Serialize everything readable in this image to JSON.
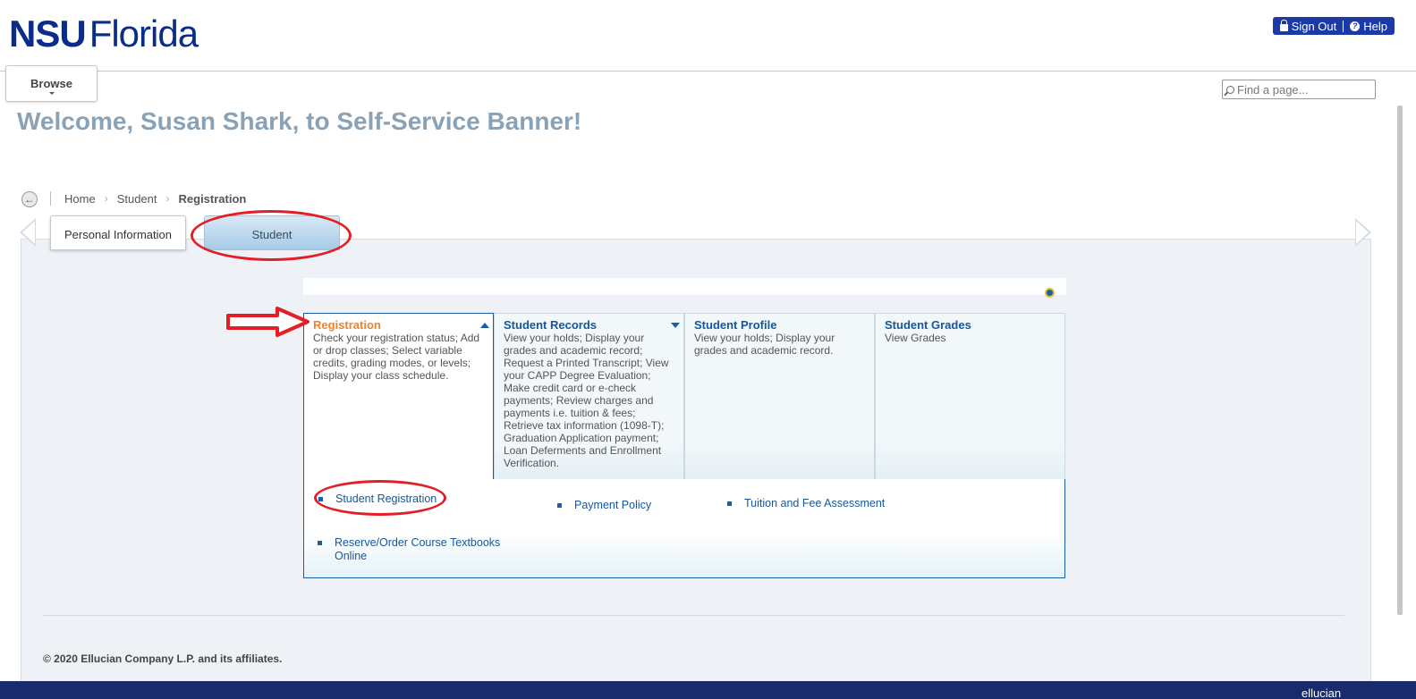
{
  "header": {
    "logo_bold": "NSU",
    "logo_light": "Florida",
    "sign_out": "Sign Out",
    "help": "Help"
  },
  "browse_label": "Browse",
  "search": {
    "placeholder": "Find a page..."
  },
  "welcome": "Welcome, Susan Shark, to Self-Service Banner!",
  "breadcrumb": {
    "items": [
      "Home",
      "Student",
      "Registration"
    ]
  },
  "tabs": [
    {
      "label": "Personal Information",
      "active": false
    },
    {
      "label": "Student",
      "active": true
    }
  ],
  "cards": [
    {
      "title": "Registration",
      "desc": "Check your registration status; Add or drop classes; Select variable credits, grading modes, or levels; Display your class schedule.",
      "active": true
    },
    {
      "title": "Student Records",
      "desc": "View your holds; Display your grades and academic record; Request a Printed Transcript; View your CAPP Degree Evaluation; Make credit card or e-check payments; Review charges and payments i.e. tuition & fees; Retrieve tax information (1098-T); Graduation Application payment; Loan Deferments and Enrollment Verification.",
      "active": false
    },
    {
      "title": "Student Profile",
      "desc": "View your holds; Display your grades and academic record.",
      "active": false
    },
    {
      "title": "Student Grades",
      "desc": "View Grades",
      "active": false
    }
  ],
  "links": [
    "Student Registration",
    "Payment Policy",
    "Tuition and Fee Assessment",
    "Reserve/Order Course Textbooks Online"
  ],
  "footer": {
    "copyright": "© 2020 Ellucian Company L.P. and its affiliates.",
    "brand": "ellucian"
  },
  "colors": {
    "brand_navy": "#0a2d8c",
    "accent_orange": "#f0822b",
    "link_blue": "#15579b",
    "annotation_red": "#e41e26"
  }
}
